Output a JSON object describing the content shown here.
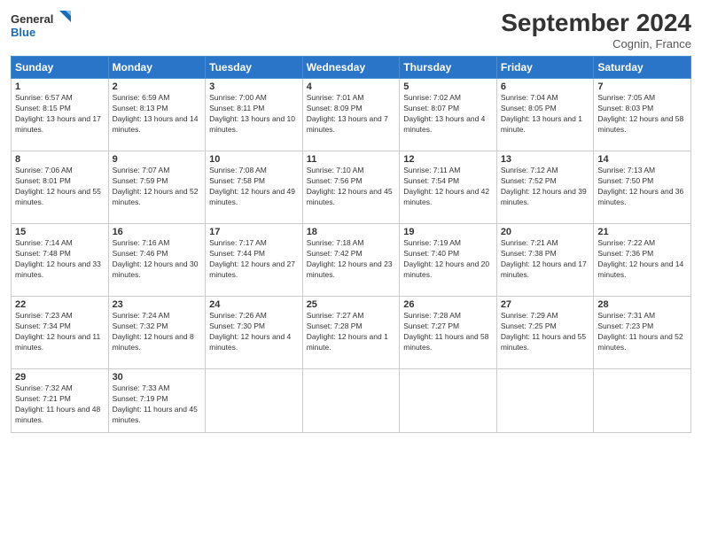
{
  "header": {
    "logo_general": "General",
    "logo_blue": "Blue",
    "month_title": "September 2024",
    "location": "Cognin, France"
  },
  "weekdays": [
    "Sunday",
    "Monday",
    "Tuesday",
    "Wednesday",
    "Thursday",
    "Friday",
    "Saturday"
  ],
  "weeks": [
    [
      {
        "day": "1",
        "info": "Sunrise: 6:57 AM\nSunset: 8:15 PM\nDaylight: 13 hours and 17 minutes."
      },
      {
        "day": "2",
        "info": "Sunrise: 6:59 AM\nSunset: 8:13 PM\nDaylight: 13 hours and 14 minutes."
      },
      {
        "day": "3",
        "info": "Sunrise: 7:00 AM\nSunset: 8:11 PM\nDaylight: 13 hours and 10 minutes."
      },
      {
        "day": "4",
        "info": "Sunrise: 7:01 AM\nSunset: 8:09 PM\nDaylight: 13 hours and 7 minutes."
      },
      {
        "day": "5",
        "info": "Sunrise: 7:02 AM\nSunset: 8:07 PM\nDaylight: 13 hours and 4 minutes."
      },
      {
        "day": "6",
        "info": "Sunrise: 7:04 AM\nSunset: 8:05 PM\nDaylight: 13 hours and 1 minute."
      },
      {
        "day": "7",
        "info": "Sunrise: 7:05 AM\nSunset: 8:03 PM\nDaylight: 12 hours and 58 minutes."
      }
    ],
    [
      {
        "day": "8",
        "info": "Sunrise: 7:06 AM\nSunset: 8:01 PM\nDaylight: 12 hours and 55 minutes."
      },
      {
        "day": "9",
        "info": "Sunrise: 7:07 AM\nSunset: 7:59 PM\nDaylight: 12 hours and 52 minutes."
      },
      {
        "day": "10",
        "info": "Sunrise: 7:08 AM\nSunset: 7:58 PM\nDaylight: 12 hours and 49 minutes."
      },
      {
        "day": "11",
        "info": "Sunrise: 7:10 AM\nSunset: 7:56 PM\nDaylight: 12 hours and 45 minutes."
      },
      {
        "day": "12",
        "info": "Sunrise: 7:11 AM\nSunset: 7:54 PM\nDaylight: 12 hours and 42 minutes."
      },
      {
        "day": "13",
        "info": "Sunrise: 7:12 AM\nSunset: 7:52 PM\nDaylight: 12 hours and 39 minutes."
      },
      {
        "day": "14",
        "info": "Sunrise: 7:13 AM\nSunset: 7:50 PM\nDaylight: 12 hours and 36 minutes."
      }
    ],
    [
      {
        "day": "15",
        "info": "Sunrise: 7:14 AM\nSunset: 7:48 PM\nDaylight: 12 hours and 33 minutes."
      },
      {
        "day": "16",
        "info": "Sunrise: 7:16 AM\nSunset: 7:46 PM\nDaylight: 12 hours and 30 minutes."
      },
      {
        "day": "17",
        "info": "Sunrise: 7:17 AM\nSunset: 7:44 PM\nDaylight: 12 hours and 27 minutes."
      },
      {
        "day": "18",
        "info": "Sunrise: 7:18 AM\nSunset: 7:42 PM\nDaylight: 12 hours and 23 minutes."
      },
      {
        "day": "19",
        "info": "Sunrise: 7:19 AM\nSunset: 7:40 PM\nDaylight: 12 hours and 20 minutes."
      },
      {
        "day": "20",
        "info": "Sunrise: 7:21 AM\nSunset: 7:38 PM\nDaylight: 12 hours and 17 minutes."
      },
      {
        "day": "21",
        "info": "Sunrise: 7:22 AM\nSunset: 7:36 PM\nDaylight: 12 hours and 14 minutes."
      }
    ],
    [
      {
        "day": "22",
        "info": "Sunrise: 7:23 AM\nSunset: 7:34 PM\nDaylight: 12 hours and 11 minutes."
      },
      {
        "day": "23",
        "info": "Sunrise: 7:24 AM\nSunset: 7:32 PM\nDaylight: 12 hours and 8 minutes."
      },
      {
        "day": "24",
        "info": "Sunrise: 7:26 AM\nSunset: 7:30 PM\nDaylight: 12 hours and 4 minutes."
      },
      {
        "day": "25",
        "info": "Sunrise: 7:27 AM\nSunset: 7:28 PM\nDaylight: 12 hours and 1 minute."
      },
      {
        "day": "26",
        "info": "Sunrise: 7:28 AM\nSunset: 7:27 PM\nDaylight: 11 hours and 58 minutes."
      },
      {
        "day": "27",
        "info": "Sunrise: 7:29 AM\nSunset: 7:25 PM\nDaylight: 11 hours and 55 minutes."
      },
      {
        "day": "28",
        "info": "Sunrise: 7:31 AM\nSunset: 7:23 PM\nDaylight: 11 hours and 52 minutes."
      }
    ],
    [
      {
        "day": "29",
        "info": "Sunrise: 7:32 AM\nSunset: 7:21 PM\nDaylight: 11 hours and 48 minutes."
      },
      {
        "day": "30",
        "info": "Sunrise: 7:33 AM\nSunset: 7:19 PM\nDaylight: 11 hours and 45 minutes."
      },
      {
        "day": "",
        "info": ""
      },
      {
        "day": "",
        "info": ""
      },
      {
        "day": "",
        "info": ""
      },
      {
        "day": "",
        "info": ""
      },
      {
        "day": "",
        "info": ""
      }
    ]
  ]
}
